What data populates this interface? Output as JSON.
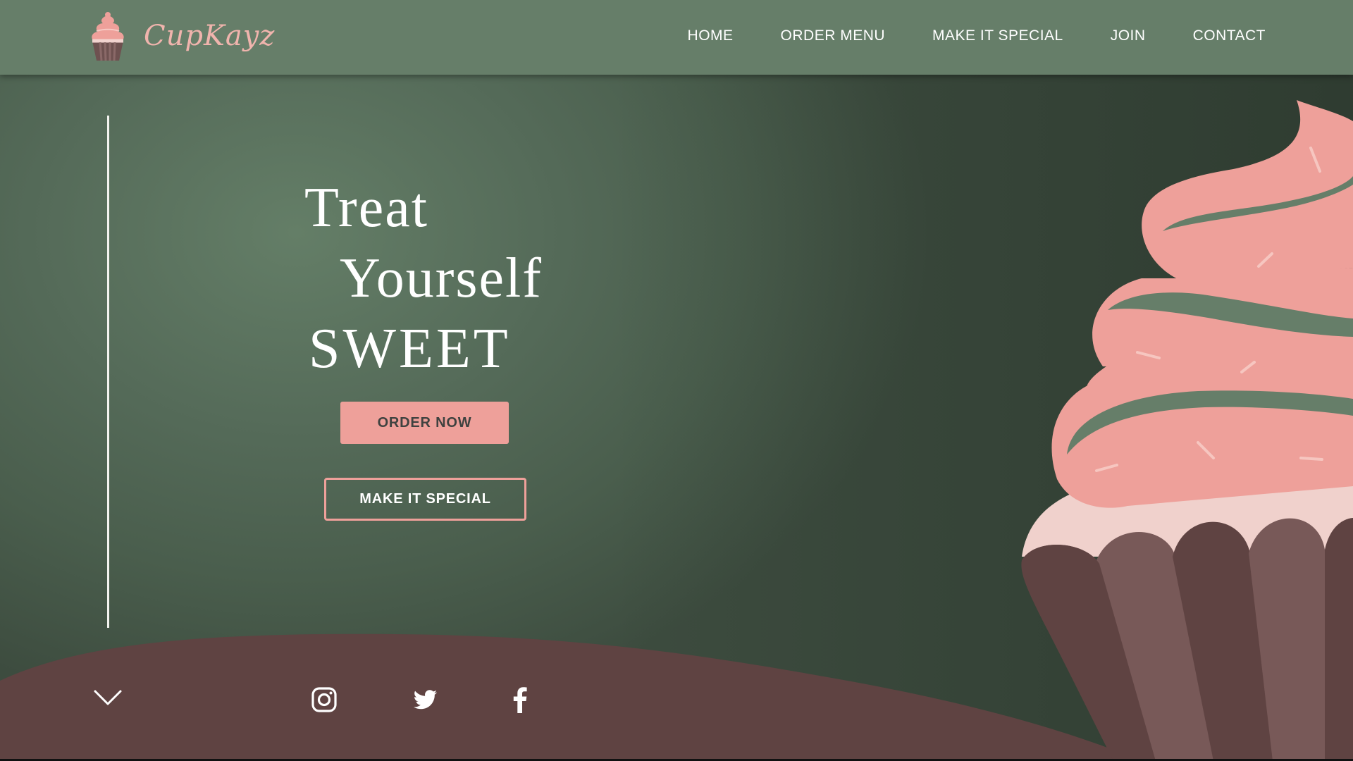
{
  "brand": {
    "name": "CupKayz",
    "logo_icon": "cupcake-icon",
    "accent_color": "#eea09a",
    "header_color": "#667e69",
    "chocolate_color": "#5f4342"
  },
  "nav": {
    "items": [
      {
        "label": "HOME"
      },
      {
        "label": "ORDER MENU"
      },
      {
        "label": "MAKE IT SPECIAL"
      },
      {
        "label": "JOIN"
      },
      {
        "label": "CONTACT"
      }
    ]
  },
  "hero": {
    "line1": "Treat",
    "line2": "Yourself",
    "line3": "SWEET",
    "primary_button": "ORDER NOW",
    "secondary_button": "MAKE IT SPECIAL",
    "illustration": "cupcake-illustration"
  },
  "footer": {
    "scroll_icon": "chevron-down-icon",
    "social": [
      {
        "icon": "instagram-icon"
      },
      {
        "icon": "twitter-icon"
      },
      {
        "icon": "facebook-icon"
      }
    ]
  }
}
